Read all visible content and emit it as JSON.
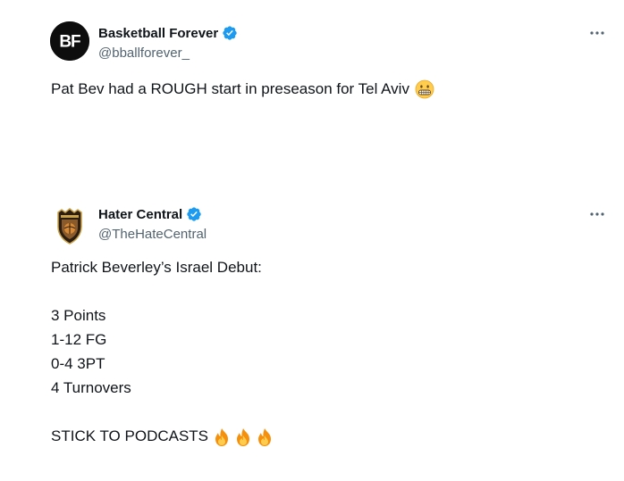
{
  "tweets": [
    {
      "display_name": "Basketball Forever",
      "handle": "@bballforever_",
      "avatar_text": "BF",
      "text": "Pat Bev had a ROUGH start in preseason for Tel Aviv",
      "emoji_icon": "grimacing-face-emoji",
      "more_icon": "more-horizontal-icon"
    },
    {
      "display_name": "Hater Central",
      "handle": "@TheHateCentral",
      "lines": [
        "Patrick Beverley’s Israel Debut:",
        "",
        "3 Points",
        "1-12 FG",
        "0-4 3PT",
        "4 Turnovers",
        "",
        "STICK TO PODCASTS"
      ],
      "emoji_icon": "fire-emoji",
      "more_icon": "more-horizontal-icon"
    }
  ],
  "colors": {
    "verified": "#1d9bf0",
    "text": "#0f1419",
    "secondary": "#536471"
  }
}
